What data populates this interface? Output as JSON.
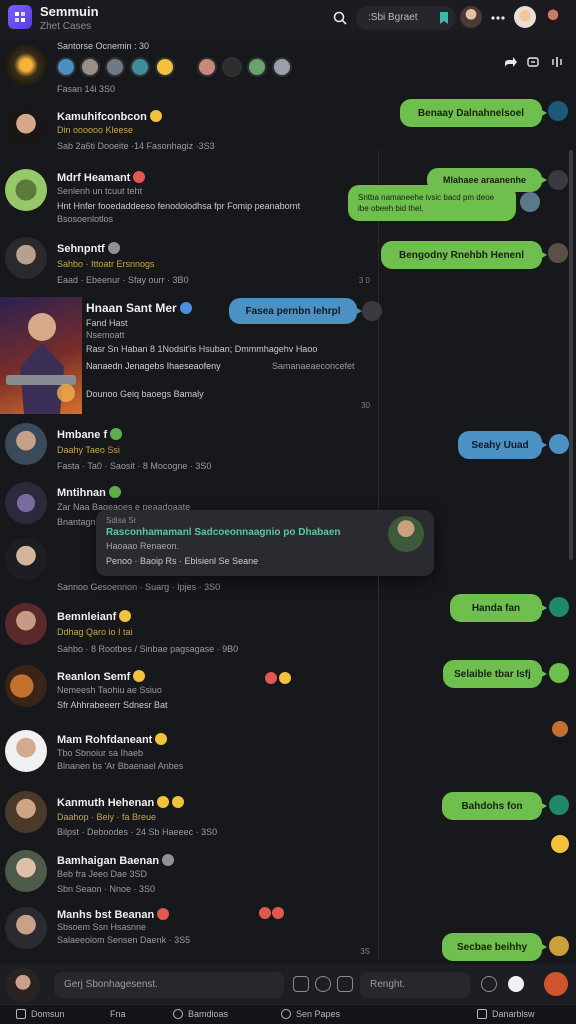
{
  "app": {
    "title": "Semmuin",
    "subtitle": "Zhet Cases",
    "search_label": ":Sbi Bgraet"
  },
  "stories": {
    "label": "Santorse Ocnemin : 30",
    "time": "Fasan 14i 3S0"
  },
  "conversations": [
    {
      "name": "Kamuhifconbcon",
      "line1": "Din oooooo Kleese",
      "line2": "Sab 2a6ti Dooeite ·14 Fasonhagiz ·3S3",
      "time": ""
    },
    {
      "name": "Mdrf Heamant",
      "line1": "Senlenh un tcuut teht",
      "line2": "Hnt Hnfer fooedaddeeso fenodolodhsa fpr Fomip peanabornt",
      "line3": "Bsosoenlotlos",
      "time": ""
    },
    {
      "name": "Sehnpntf",
      "line1": "Sahbo · Ittoatr Ersnnogs",
      "line2": "Eaad · Ebeenur · Sfay ourr · 3B0",
      "time": "3 0"
    },
    {
      "name": "Hnaan Sant Mer",
      "line1": "Fand Hast",
      "line2": "Nsemoatt",
      "line3": "Rasr Sn Haban 8 1Nodsit'is Hsuban; Dmmmhagehv Haoo",
      "line4": "Nanaedn Jenagebs Ihaeseaofeny",
      "line5": "Dounoo Geiq baoegs Bamaly",
      "side": "Samanaeaeconcefet",
      "time": "30"
    },
    {
      "name": "Hmbane f",
      "line1": "Daahy Taeo Ssi",
      "line2": "Fasta · Ta0 · Saosit · 8 Mocogne · 3S0",
      "time": ""
    },
    {
      "name": "Mntihnan",
      "line1": "Zar Naa Bageaoes e peaadoaate",
      "line2": "Bnantagn:",
      "time": ""
    },
    {
      "name": "",
      "line1": "",
      "line2": "Sannoo Gesoennon · Suarg · Ipjes · 3S0",
      "time": ""
    },
    {
      "name": "Bemnleianf",
      "line1": "Ddhag Qaro io I tai",
      "line2": "Sahbo · 8 Rootbes / Sinbae pagsagase · 9B0",
      "time": ""
    },
    {
      "name": "Reanlon Semf",
      "line1": "Nemeesh Taohiu ae Ssiuo",
      "line2": "Sfr Ahhrabeeerr Sdnesr Bat",
      "time": ""
    },
    {
      "name": "Mam Rohfdaneant",
      "line1": "Tbo Sbnoiur sa Ihaeb",
      "line2": "Blnanen bs 'Ar Bbaenael Anbes",
      "time": ""
    },
    {
      "name": "Kanmuth Hehenan",
      "line1": "Daahop · Beiy · fa Breue",
      "line2": "Bilpst · Deboodes · 24 Sb Haeeec · 3S0",
      "time": ""
    },
    {
      "name": "Bamhaigan Baenan",
      "line1": "Beb fra Jeeo Dae 3SD",
      "line2": "Sbn Seaon · Nnoe · 3S0",
      "time": ""
    },
    {
      "name": "Manhs bst Beanan",
      "line1": "Sbsoem Ssn Hsasnne",
      "line2": "Salaeeoiom Sensen Daenk · 3S5",
      "time": "3S"
    }
  ],
  "popup": {
    "top": "Sdisa Sr",
    "title": "Rasconhamamanl Sadcoeonnaagnio po Dhabaen",
    "sub": "Haoaao Renaeon.",
    "footer": "Penoo · Baoip Rs · Eblsienl Se Seane"
  },
  "chat": [
    {
      "text": "Benaay Dalnahnelsoel",
      "style": "green"
    },
    {
      "text": "Mlahaee araanenhe",
      "style": "green"
    },
    {
      "text": "Sntba namaneehe ivsic bacd pm deoe ibe obeeh bid thel,",
      "style": "green"
    },
    {
      "text": "Bengodny Rnehbh Henenl",
      "style": "green"
    },
    {
      "text": "Fasea pernbn lehrpl",
      "style": "blue"
    },
    {
      "text": "Seahy Uuad",
      "style": "blue"
    },
    {
      "text": "Handa fan",
      "style": "green"
    },
    {
      "text": "Selaible tbar Isfj",
      "style": "green"
    },
    {
      "text": "Bahdohs fon",
      "style": "green"
    },
    {
      "text": "Secbae beihhy",
      "style": "green"
    }
  ],
  "composer": {
    "placeholder": "Gerj Sbonhagesenst.",
    "reply_placeholder": "Renght."
  },
  "nav": {
    "item1": "Domsun",
    "item2": "Fna",
    "item3": "Bamdioas",
    "item4": "Sen Papes",
    "item5": "Danarblsw"
  },
  "colors": {
    "bubble_green": "#6fbf4e",
    "bubble_blue": "#4b91c4",
    "accent": "#7c5cff",
    "send": "#d2542e"
  }
}
